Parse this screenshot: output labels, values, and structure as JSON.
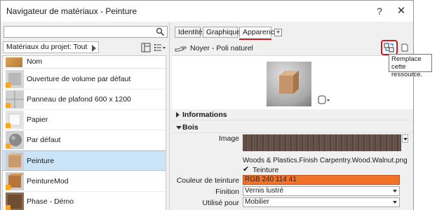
{
  "window": {
    "title": "Navigateur de matériaux - Peinture",
    "help_label": "?",
    "close_label": "✕"
  },
  "left": {
    "search_placeholder": "",
    "project_filter": "Matériaux du projet: Tout",
    "column_header": "Nom",
    "materials": [
      {
        "label": "Ouverture de volume par défaut",
        "thumb": "grey-cube"
      },
      {
        "label": "Panneau de plafond 600 x 1200",
        "thumb": "grey-tile"
      },
      {
        "label": "Papier",
        "thumb": "white-cube"
      },
      {
        "label": "Par défaut",
        "thumb": "grey-sphere"
      },
      {
        "label": "Peinture",
        "thumb": "wood-cube",
        "selected": true
      },
      {
        "label": "PeintureMod",
        "thumb": "wood-cube"
      },
      {
        "label": "Phase - Démo",
        "thumb": "wood-dark"
      }
    ]
  },
  "tabs": [
    {
      "label": "Identité"
    },
    {
      "label": "Graphiques"
    },
    {
      "label": "Apparence",
      "active": true
    }
  ],
  "tab_add_label": "+",
  "asset": {
    "name": "Noyer - Poli naturel"
  },
  "sections": {
    "informations": "Informations",
    "bois": "Bois"
  },
  "properties": {
    "image_label": "Image",
    "image_path": "Woods & Plastics.Finish Carpentry.Wood.Walnut.png",
    "tint_checkbox_label": "Teinture",
    "tint_checked": true,
    "tint_color_label": "Couleur de teinture",
    "tint_color_value": "RGB 240 114 41",
    "tint_color_hex": "#f07229",
    "finish_label": "Finition",
    "finish_value": "Vernis lustré",
    "use_label": "Utilisé pour",
    "use_value": "Mobilier"
  },
  "tooltip": {
    "line1": "Remplace cette",
    "line2": "ressource."
  },
  "colors": {
    "highlight": "#d4181e",
    "selection": "#cce4f7",
    "accent_orange": "#f6a624"
  }
}
